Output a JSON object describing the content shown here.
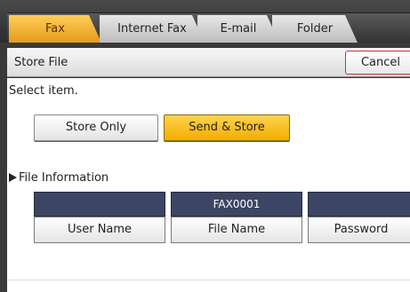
{
  "tabs": [
    {
      "label": "Fax",
      "active": true
    },
    {
      "label": "Internet Fax",
      "active": false
    },
    {
      "label": "E-mail",
      "active": false
    },
    {
      "label": "Folder",
      "active": false
    }
  ],
  "header": {
    "title": "Store File",
    "cancel_label": "Cancel"
  },
  "prompt": "Select item.",
  "options": {
    "store_only": "Store Only",
    "send_store": "Send & Store",
    "selected": "Send & Store"
  },
  "file_info": {
    "section_label": "File Information",
    "user_name": {
      "value": "",
      "label": "User Name"
    },
    "file_name": {
      "value": "FAX0001",
      "label": "File Name"
    },
    "password": {
      "value": "",
      "label": "Password"
    }
  },
  "colors": {
    "active_tab": "#f2ae00",
    "selected_button": "#ffd24d",
    "info_value_bg": "#3c4664",
    "cancel_border": "#c0392b"
  }
}
